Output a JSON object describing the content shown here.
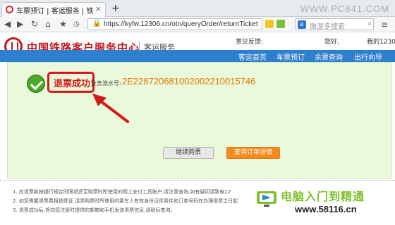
{
  "browser": {
    "tab_title": "车票预订 | 客运服务 | 铁路客...",
    "tab_close": "×",
    "new_tab": "+",
    "url": "https://kyfw.12306.cn/otn/queryOrder/returnTicket",
    "search_placeholder": "微游多搜索",
    "search_engine_glyph": "e",
    "watermark": "WWW.PC841.COM",
    "back_glyph": "◀",
    "forward_glyph": "▶",
    "reload_glyph": "↻",
    "home_glyph": "⌂",
    "star_glyph": "★",
    "menu_glyph": "≡"
  },
  "header": {
    "logo_text": "中国铁路客户服务中心",
    "sub_text": "客运服务",
    "feedback": "意见反馈:",
    "hello": "您好,",
    "my12306": "我的12306",
    "brand_color": "#c4161c"
  },
  "nav": {
    "items": [
      "客运首页",
      "车票预订",
      "余票查询",
      "出行向导"
    ],
    "bar_color": "#2d7fcf"
  },
  "result": {
    "success_text": "退票成功!",
    "serial_label": "业务流水号:",
    "serial_value": "2E228720681002002210015746",
    "continue_button": "继续购票",
    "detail_button": "查询订单详情",
    "accent_color": "#d2191c"
  },
  "notes": [
    "1. 应退票款按银行规定时限退还至购票时所使用的网上支付工具账户,请注意查询,如有疑问请致电12",
    "2. 如您需要退票费报销凭证,请凭购票时所使用的乘车人有效身份证件原件和订单号码在办理退票之日起",
    "3. 退票成功后,将向您注册时提供的邮箱和手机发送退票信息,请稍后查询。"
  ],
  "watermark_bottom": {
    "brand": "电脑入门到精通",
    "url": "www.58116.cn"
  }
}
